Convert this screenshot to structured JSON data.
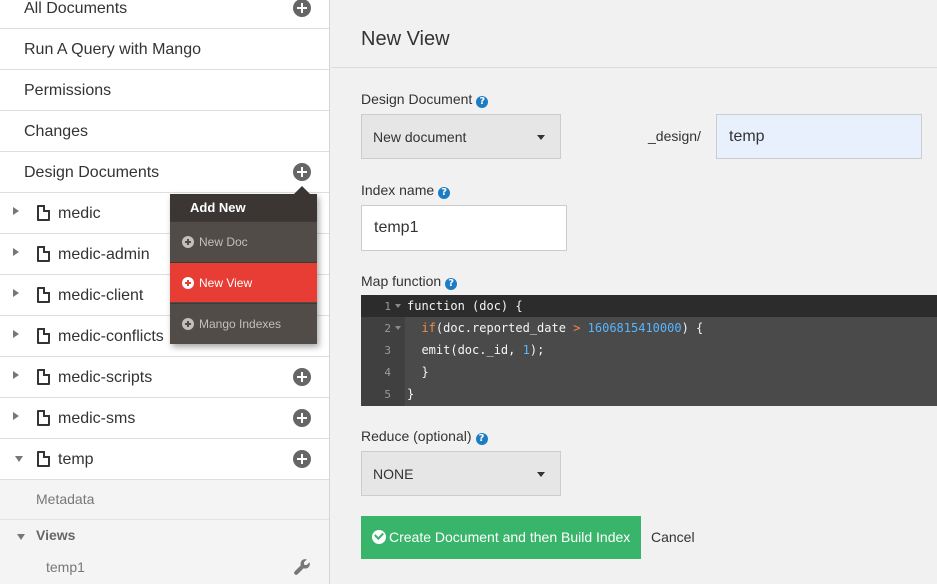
{
  "sidebar": {
    "items": [
      {
        "label": "All Documents"
      },
      {
        "label": "Run A Query with Mango"
      },
      {
        "label": "Permissions"
      },
      {
        "label": "Changes"
      },
      {
        "label": "Design Documents"
      }
    ],
    "design_docs": [
      {
        "label": "medic"
      },
      {
        "label": "medic-admin"
      },
      {
        "label": "medic-client"
      },
      {
        "label": "medic-conflicts"
      },
      {
        "label": "medic-scripts"
      },
      {
        "label": "medic-sms"
      },
      {
        "label": "temp"
      }
    ],
    "sub": {
      "metadata": "Metadata",
      "views": "Views",
      "view_item": "temp1"
    }
  },
  "menu": {
    "header": "Add New",
    "items": [
      {
        "label": "New Doc"
      },
      {
        "label": "New View"
      },
      {
        "label": "Mango Indexes"
      }
    ]
  },
  "main": {
    "title": "New View",
    "design_doc_label": "Design Document",
    "design_doc_select": "New document",
    "design_prefix": "_design/",
    "design_name": "temp",
    "index_name_label": "Index name",
    "index_name": "temp1",
    "map_label": "Map function",
    "code": {
      "line_numbers": [
        "1",
        "2",
        "3",
        "4",
        "5"
      ],
      "l1": "function (doc) {",
      "l2_if": "if",
      "l2_a": "(doc.reported_date ",
      "l2_op": ">",
      "l2_sp": " ",
      "l2_num": "1606815410000",
      "l2_b": ") {",
      "l3_a": "emit(doc._id, ",
      "l3_num": "1",
      "l3_b": ");",
      "l4": "}",
      "l5": "}"
    },
    "reduce_label": "Reduce (optional)",
    "reduce_select": "NONE",
    "create_button": "Create Document and then Build Index",
    "cancel_button": "Cancel",
    "help_glyph": "?"
  },
  "colors": {
    "accent_red": "#e73d34",
    "accent_green": "#38b56a",
    "help_blue": "#1d7cc4"
  }
}
